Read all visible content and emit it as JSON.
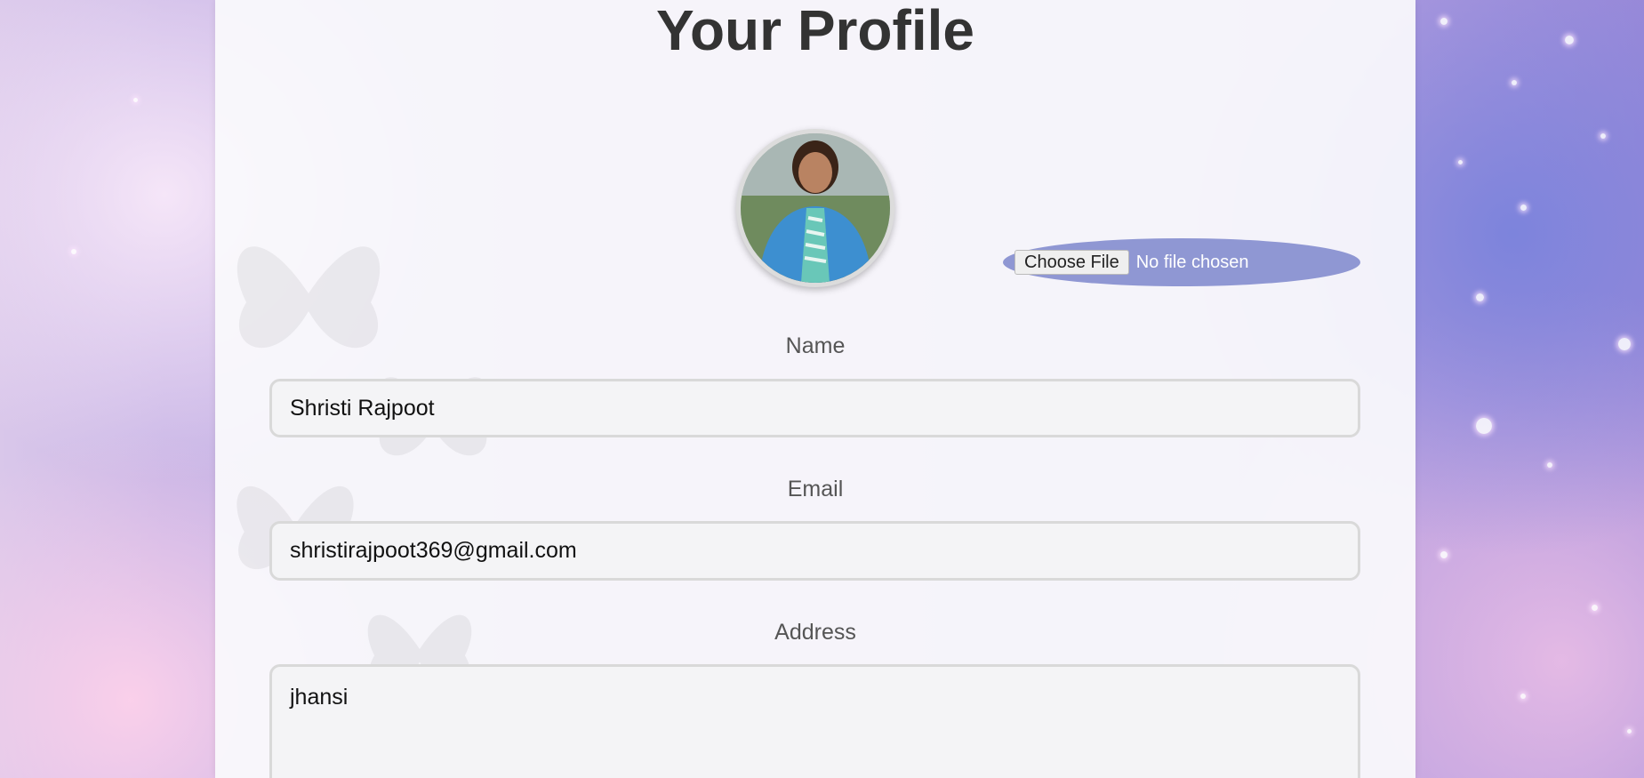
{
  "page": {
    "title": "Your Profile"
  },
  "profile": {
    "avatar_alt": "Profile photo",
    "file_input": {
      "button_label": "Choose File",
      "status_text": "No file chosen"
    }
  },
  "form": {
    "name": {
      "label": "Name",
      "value": "Shristi Rajpoot"
    },
    "email": {
      "label": "Email",
      "value": "shristirajpoot369@gmail.com"
    },
    "address": {
      "label": "Address",
      "value": "jhansi"
    }
  },
  "colors": {
    "file_chooser_bg": "#8f97d3",
    "title_color": "#333333",
    "label_color": "#555555"
  }
}
